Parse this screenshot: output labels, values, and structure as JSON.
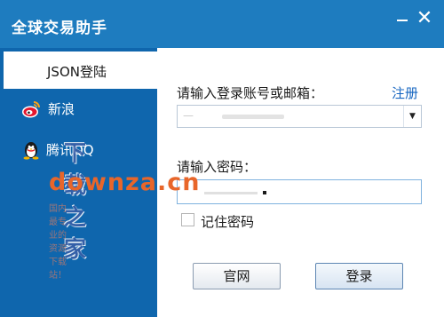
{
  "window": {
    "title": "全球交易助手",
    "minimize_icon": "minimize-icon",
    "close_icon": "close-icon",
    "close_glyph": "✕"
  },
  "sidebar": {
    "items": [
      {
        "label": "JSON登陆",
        "active": true,
        "icon": ""
      },
      {
        "label": "新浪",
        "active": false,
        "icon": "sina-weibo-icon"
      },
      {
        "label": "腾讯QQ",
        "active": false,
        "icon": "qq-penguin-icon"
      }
    ]
  },
  "form": {
    "account_label": "请输入登录账号或邮箱：",
    "register_label": "注册",
    "account_value": "—",
    "password_label": "请输入密码：",
    "remember_label": "记住密码",
    "site_button": "官网",
    "login_button": "登录",
    "dropdown_glyph": "▼"
  },
  "watermark": {
    "main": "下载之家",
    "url": "downza.cn",
    "slogan": "国内最专业的资源下载站！"
  },
  "colors": {
    "title_bar": "#1e7cbf",
    "sidebar": "#0f66ad",
    "link": "#1565c0"
  }
}
